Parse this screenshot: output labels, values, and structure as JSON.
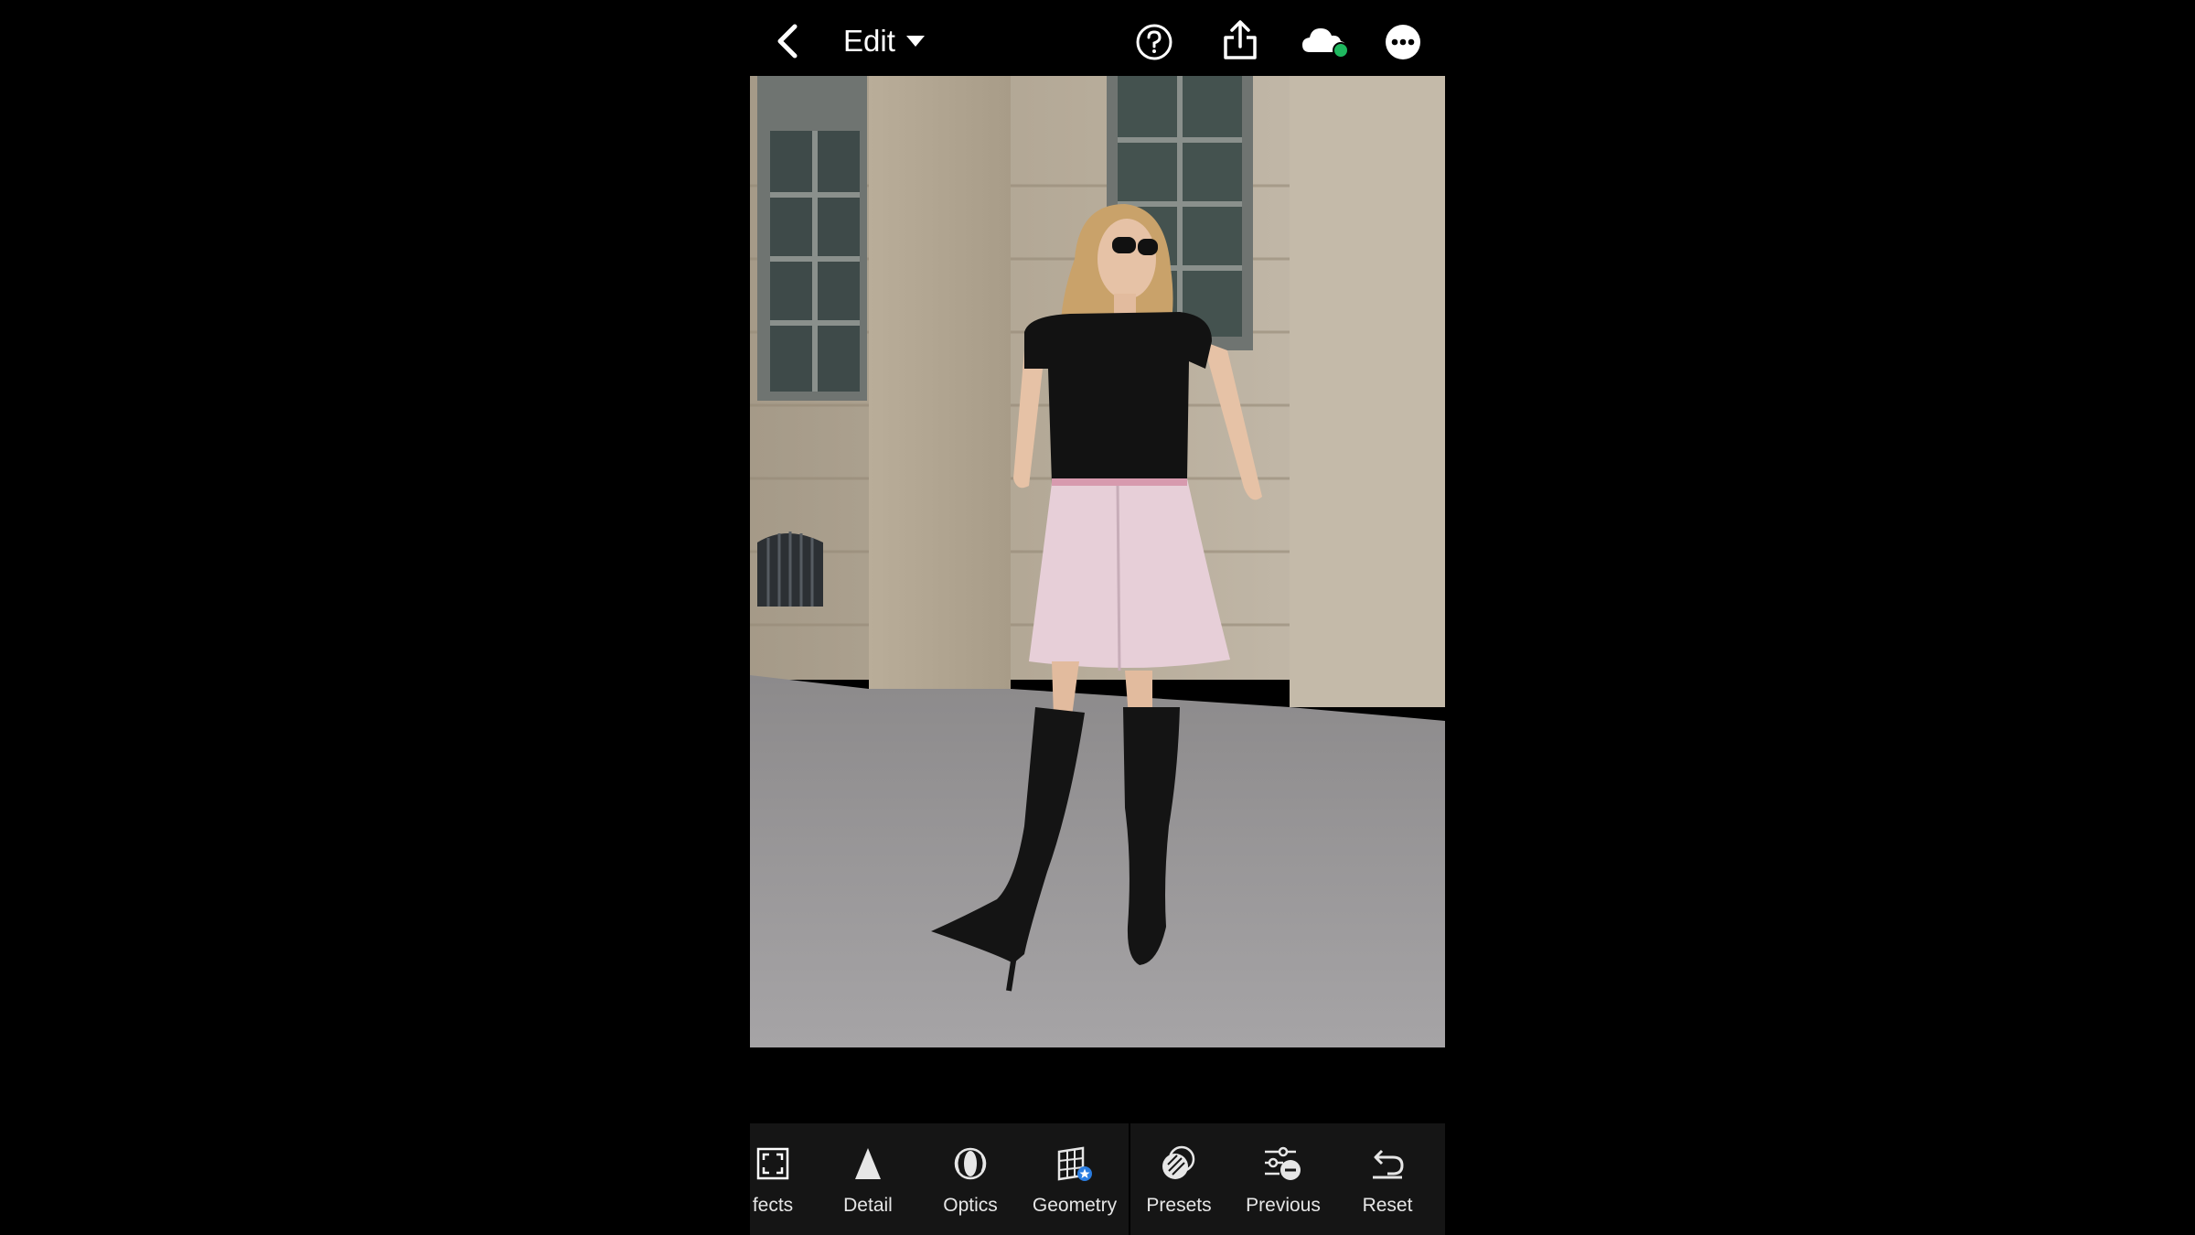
{
  "header": {
    "title": "Edit"
  },
  "toolbar": {
    "panel_tools": [
      {
        "label": "fects",
        "icon": "effects-icon"
      },
      {
        "label": "Detail",
        "icon": "detail-icon"
      },
      {
        "label": "Optics",
        "icon": "optics-icon"
      },
      {
        "label": "Geometry",
        "icon": "geometry-icon"
      }
    ],
    "action_tools": [
      {
        "label": "Presets",
        "icon": "presets-icon"
      },
      {
        "label": "Previous",
        "icon": "previous-icon"
      },
      {
        "label": "Reset",
        "icon": "reset-icon"
      }
    ]
  },
  "colors": {
    "background": "#000000",
    "toolbar": "#151515",
    "sync_status": "#1fb85f",
    "geometry_badge": "#2a7de1"
  }
}
